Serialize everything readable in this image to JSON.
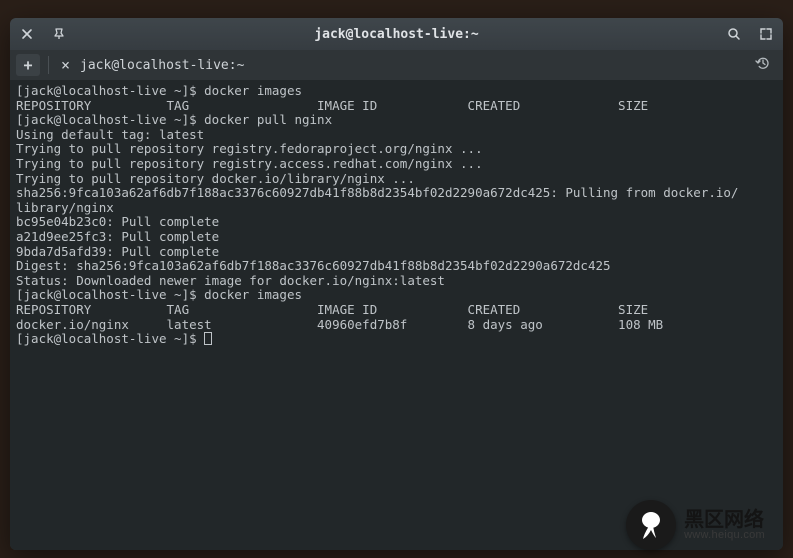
{
  "window": {
    "title": "jack@localhost-live:~"
  },
  "tab": {
    "label": "jack@localhost-live:~"
  },
  "prompt": "[jack@localhost-live ~]$ ",
  "cmd1": "docker images",
  "hdr": "REPOSITORY          TAG                 IMAGE ID            CREATED             SIZE",
  "cmd2": "docker pull nginx",
  "lines": [
    "Using default tag: latest",
    "Trying to pull repository registry.fedoraproject.org/nginx ...",
    "Trying to pull repository registry.access.redhat.com/nginx ...",
    "Trying to pull repository docker.io/library/nginx ...",
    "sha256:9fca103a62af6db7f188ac3376c60927db41f88b8d2354bf02d2290a672dc425: Pulling from docker.io/",
    "library/nginx",
    "bc95e04b23c0: Pull complete",
    "a21d9ee25fc3: Pull complete",
    "9bda7d5afd39: Pull complete",
    "Digest: sha256:9fca103a62af6db7f188ac3376c60927db41f88b8d2354bf02d2290a672dc425",
    "Status: Downloaded newer image for docker.io/nginx:latest"
  ],
  "cmd3": "docker images",
  "row": "docker.io/nginx     latest              40960efd7b8f        8 days ago          108 MB",
  "watermark": {
    "cn": "黑区网络",
    "url": "www.heiqu.com"
  }
}
